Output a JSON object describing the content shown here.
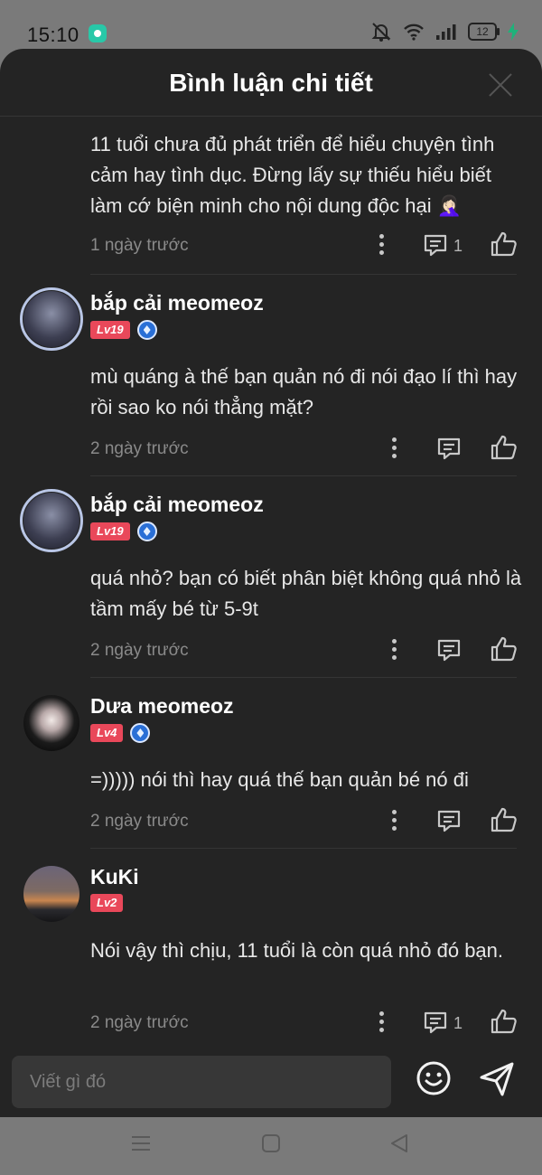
{
  "status_bar": {
    "time": "15:10",
    "battery": "12"
  },
  "sheet": {
    "title": "Bình luận chi tiết"
  },
  "comments": [
    {
      "text": "11 tuổi chưa đủ phát triển để hiểu chuyện tình cảm hay tình dục. Đừng lấy sự thiếu hiểu biết làm cớ biện minh cho nội dung độc hại 🤦🏻‍♀️",
      "time": "1 ngày trước",
      "reply_count": "1"
    },
    {
      "author": "bắp cải meomeoz",
      "level": "Lv19",
      "text": "mù quáng à thế bạn quản nó đi nói đạo lí thì hay rồi sao ko nói thẳng mặt?",
      "time": "2 ngày trước"
    },
    {
      "author": "bắp cải meomeoz",
      "level": "Lv19",
      "text": "quá nhỏ? bạn có biết phân biệt không quá nhỏ là tầm mấy bé từ 5-9t",
      "time": "2 ngày trước"
    },
    {
      "author": "Dưa meomeoz",
      "level": "Lv4",
      "text": "=))))) nói thì hay quá thế bạn quản bé nó đi",
      "time": "2 ngày trước"
    },
    {
      "author": "KuKi",
      "level": "Lv2",
      "text": "Nói vậy thì chịu, 11 tuổi là còn quá nhỏ đó bạn.",
      "time": "2 ngày trước",
      "reply_count": "1"
    }
  ],
  "composer": {
    "placeholder": "Viết gì đó"
  },
  "colors": {
    "sheet_bg": "#242424",
    "level_badge": "#e9485a",
    "vip_badge": "#2a6fd6"
  }
}
